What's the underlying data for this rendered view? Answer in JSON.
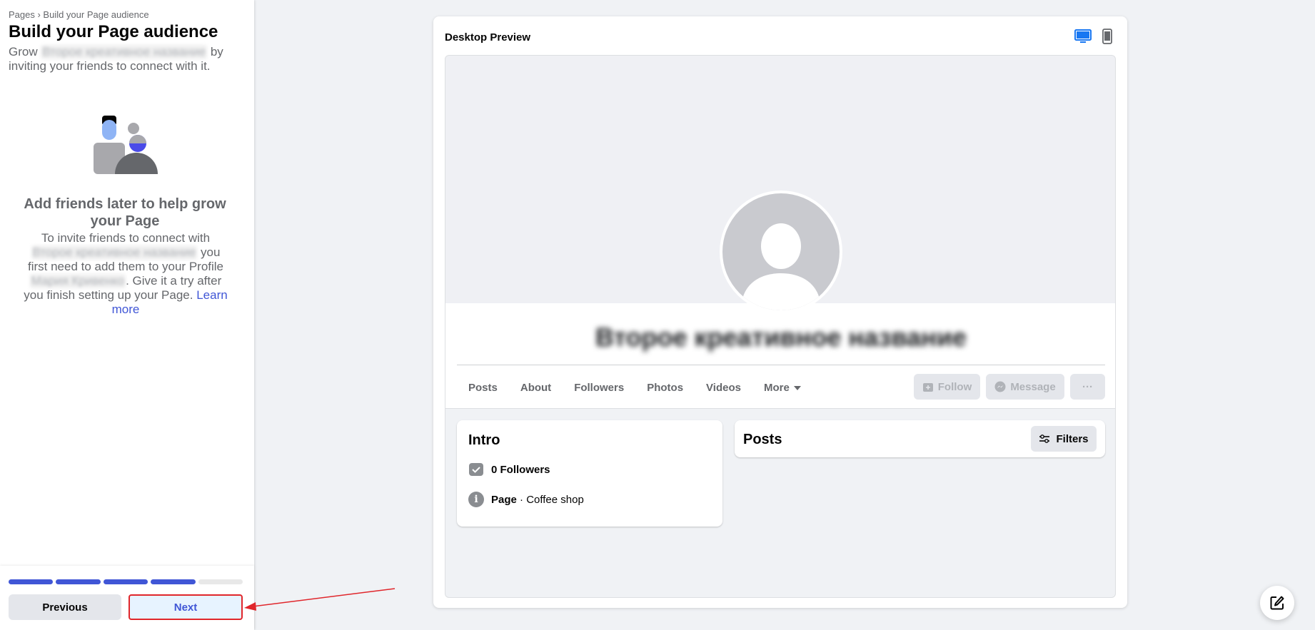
{
  "sidebar": {
    "breadcrumb": "Pages › Build your Page audience",
    "title": "Build your Page audience",
    "subtitle_start": "Grow ",
    "subtitle_name": "Второе креативное название",
    "subtitle_end": " by inviting your friends to connect with it.",
    "empty_title": "Add friends later to help grow your Page",
    "empty_body_1": "To invite friends to connect with ",
    "empty_body_name": "Второе креативное название",
    "empty_body_2": " you first need to add them to your Profile ",
    "empty_body_profile": "Мария Кривенко",
    "empty_body_3": ". Give it a try after you finish setting up your Page. ",
    "learn_more": "Learn more",
    "progress": {
      "completed": 4,
      "total": 5
    },
    "previous_label": "Previous",
    "next_label": "Next"
  },
  "preview": {
    "title": "Desktop Preview",
    "page_name": "Второе креативное название",
    "tabs": [
      "Posts",
      "About",
      "Followers",
      "Photos",
      "Videos",
      "More"
    ],
    "follow_label": "Follow",
    "message_label": "Message",
    "more_actions": "···",
    "intro": {
      "title": "Intro",
      "followers": "0 Followers",
      "page_label": "Page",
      "category": " · Coffee shop"
    },
    "posts": {
      "title": "Posts",
      "filters_label": "Filters"
    }
  },
  "colors": {
    "accent": "#4056d6",
    "highlight": "#e0262b",
    "desktop_icon": "#1877f2"
  },
  "icons": [
    "desktop-icon",
    "mobile-icon",
    "follow-icon",
    "messenger-icon",
    "filters-icon",
    "followers-icon",
    "info-icon",
    "edit-icon"
  ]
}
